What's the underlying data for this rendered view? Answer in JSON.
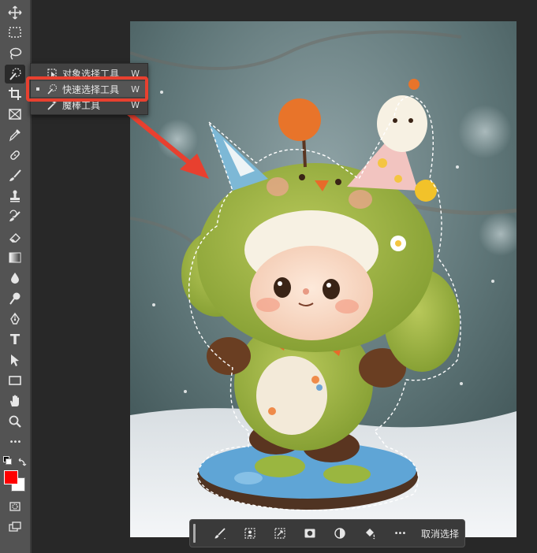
{
  "toolbar": {
    "tools": [
      "move-tool",
      "marquee-tool",
      "lasso-tool",
      "quick-selection-tool",
      "crop-tool",
      "frame-tool",
      "eyedropper-tool",
      "healing-brush-tool",
      "brush-tool",
      "clone-stamp-tool",
      "history-brush-tool",
      "eraser-tool",
      "gradient-tool",
      "blur-tool",
      "dodge-tool",
      "pen-tool",
      "type-tool",
      "path-selection-tool",
      "rectangle-tool",
      "hand-tool",
      "zoom-tool",
      "more-tools"
    ],
    "type_tool_glyph": "T",
    "more_glyph": "•••",
    "foreground_color": "#ff0000",
    "background_color": "#ffffff"
  },
  "flyout": {
    "items": [
      {
        "label": "对象选择工具",
        "shortcut": "W",
        "icon": "object-selection-icon"
      },
      {
        "label": "快速选择工具",
        "shortcut": "W",
        "icon": "quick-selection-icon",
        "active": true
      },
      {
        "label": "魔棒工具",
        "shortcut": "W",
        "icon": "magic-wand-icon"
      }
    ]
  },
  "annotation": {
    "highlight_color": "#e8402f"
  },
  "context_bar": {
    "buttons": [
      "brush-settings-icon",
      "select-subject-icon",
      "select-and-mask-icon",
      "mask-icon",
      "adjustment-icon",
      "fill-icon",
      "more-icon"
    ],
    "more_glyph": "•••",
    "deselect_label": "取消选择"
  }
}
